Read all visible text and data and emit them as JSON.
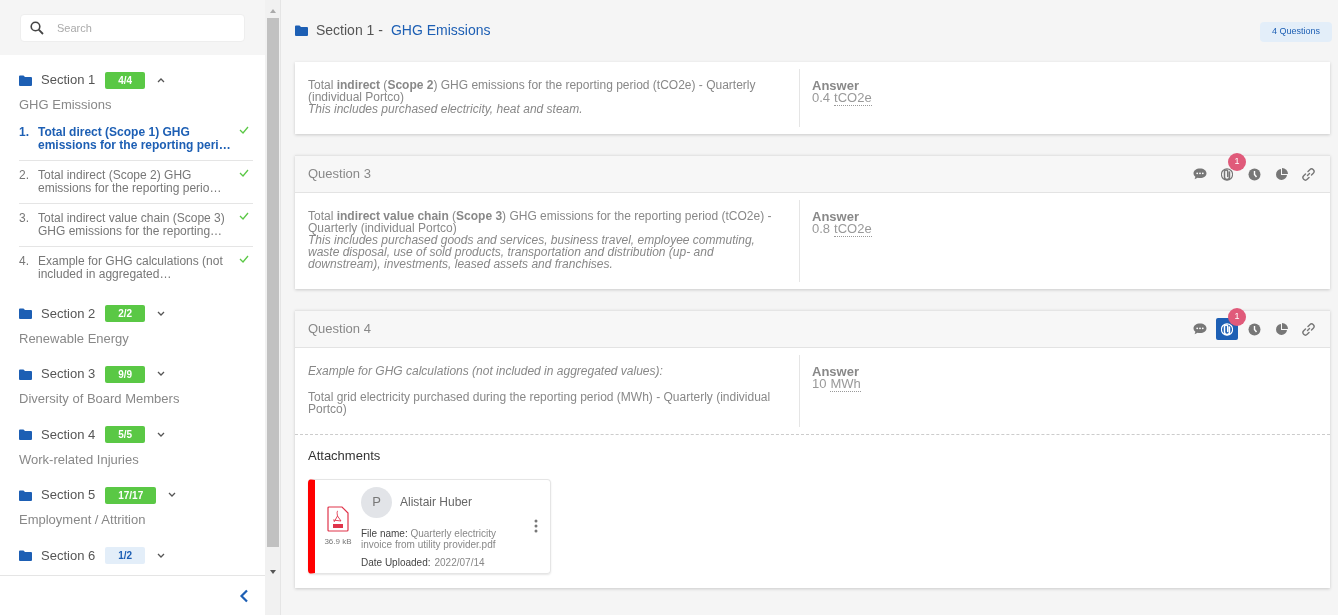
{
  "sidebar": {
    "search": {
      "placeholder": "Search"
    },
    "sections": [
      {
        "title": "Section 1",
        "badge": "4/4",
        "complete": true,
        "expanded": true,
        "subtitle": "GHG Emissions",
        "questions": [
          {
            "number": "1.",
            "text": "Total direct (Scope 1) GHG emissions for the reporting peri…",
            "selected": true,
            "answered": true
          },
          {
            "number": "2.",
            "text": "Total indirect (Scope 2) GHG emissions for the reporting perio…",
            "selected": false,
            "answered": true
          },
          {
            "number": "3.",
            "text": "Total indirect value chain (Scope 3) GHG emissions for the reporting…",
            "selected": false,
            "answered": true
          },
          {
            "number": "4.",
            "text": "Example for GHG calculations (not included in aggregated…",
            "selected": false,
            "answered": true
          }
        ]
      },
      {
        "title": "Section 2",
        "badge": "2/2",
        "complete": true,
        "expanded": false,
        "subtitle": "Renewable Energy"
      },
      {
        "title": "Section 3",
        "badge": "9/9",
        "complete": true,
        "expanded": false,
        "subtitle": "Diversity of Board Members"
      },
      {
        "title": "Section 4",
        "badge": "5/5",
        "complete": true,
        "expanded": false,
        "subtitle": "Work-related Injuries"
      },
      {
        "title": "Section 5",
        "badge": "17/17",
        "complete": true,
        "expanded": false,
        "subtitle": "Employment / Attrition"
      },
      {
        "title": "Section 6",
        "badge": "1/2",
        "complete": false,
        "expanded": false
      }
    ]
  },
  "header": {
    "prefix": "Section 1 -",
    "title": "GHG Emissions",
    "count": "4 Questions"
  },
  "questions": [
    {
      "text": "Total **indirect** (**Scope 2**) GHG emissions for the reporting period (tCO2e) - Quarterly (individual Portco)",
      "note": "This includes purchased electricity, heat and steam.",
      "answer": {
        "label": "Answer",
        "value": "0.4",
        "unit": "tCO2e"
      }
    },
    {
      "title": "Question 3",
      "toolbar": {
        "attachments_count": "1",
        "attachments_active": false
      },
      "text": "Total **indirect value chain** (**Scope 3**) GHG emissions for the reporting period (tCO2e) - Quarterly (individual Portco)",
      "note": "This includes purchased goods and services, business travel, employee commuting, waste disposal, use of sold products, transportation and distribution (up- and downstream), investments, leased assets and franchises.",
      "answer": {
        "label": "Answer",
        "value": "0.8",
        "unit": "tCO2e"
      }
    },
    {
      "title": "Question 4",
      "toolbar": {
        "attachments_count": "1",
        "attachments_active": true
      },
      "intro": "Example for GHG calculations (not included in aggregated values):",
      "text": "Total grid electricity purchased during the reporting period (MWh) - Quarterly (individual Portco)",
      "answer": {
        "label": "Answer",
        "value": "10",
        "unit": "MWh"
      },
      "attachments": {
        "title": "Attachments",
        "files": [
          {
            "size": "36.9 kB",
            "avatar": "P",
            "uploader": "Alistair Huber",
            "file_label": "File name:",
            "file_name": "Quarterly electricity invoice from utility provider.pdf",
            "date_label": "Date Uploaded:",
            "date": "2022/07/14"
          }
        ]
      }
    }
  ]
}
